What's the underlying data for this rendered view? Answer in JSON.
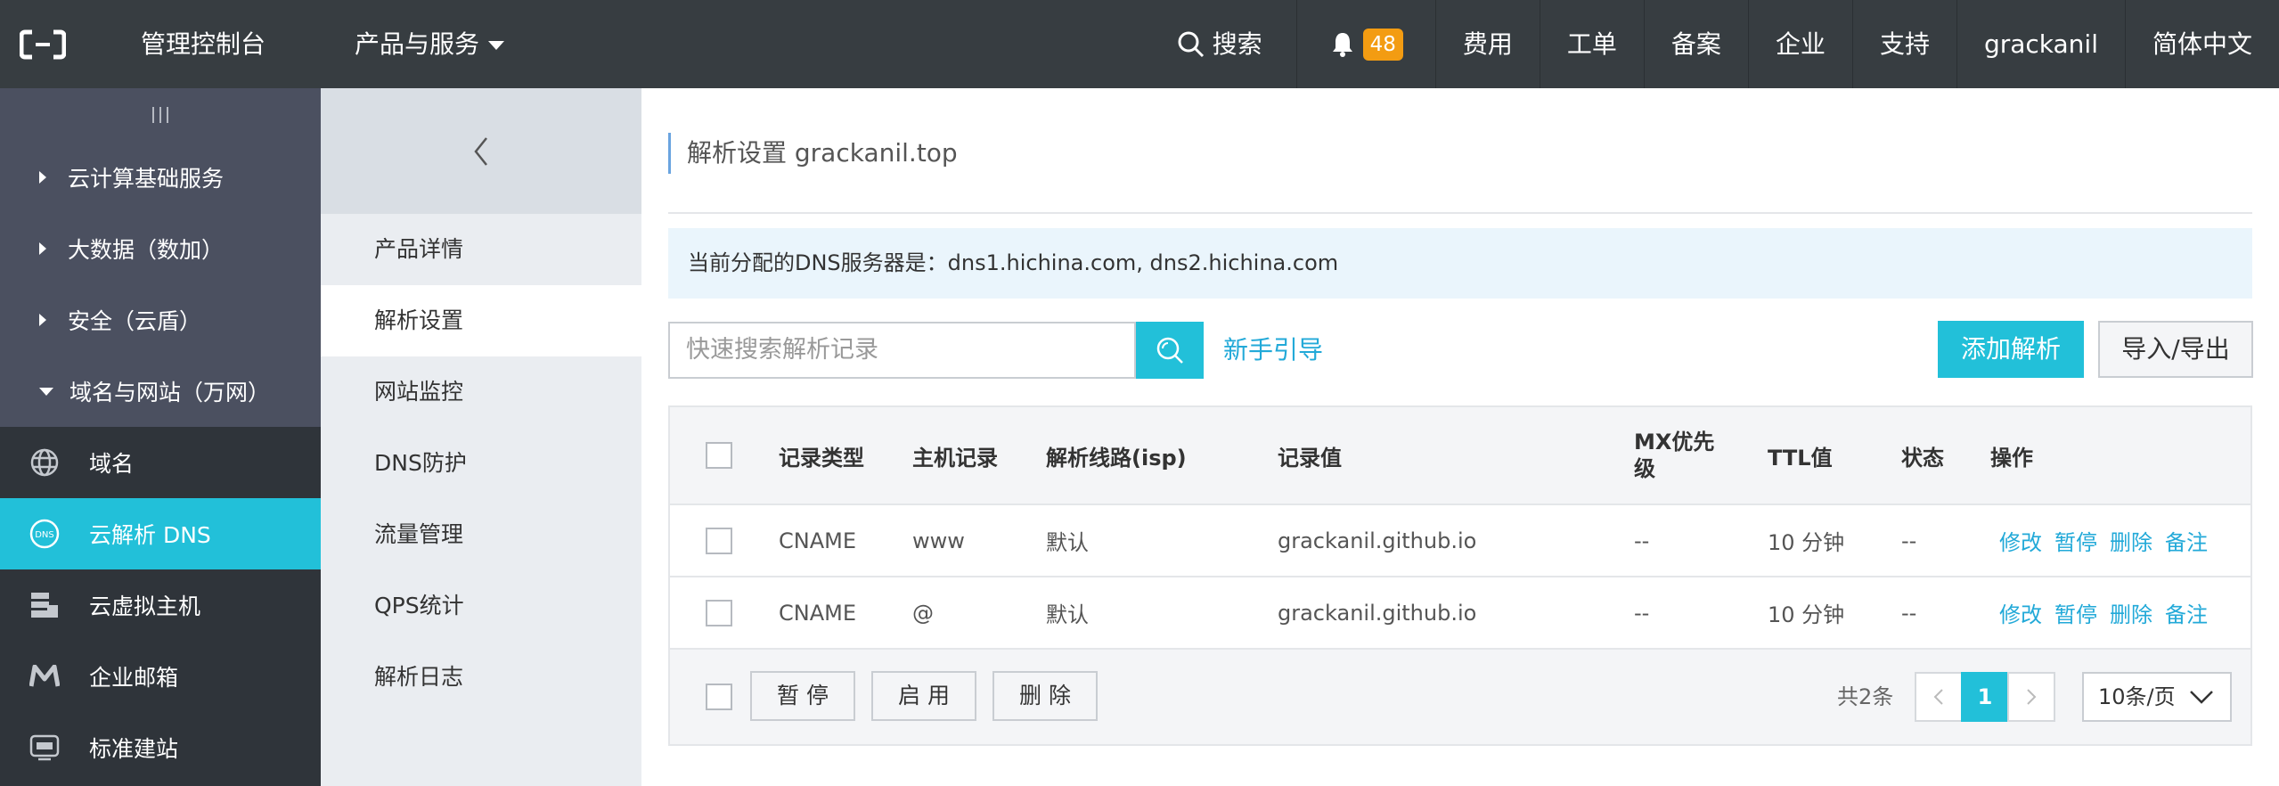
{
  "topbar": {
    "brand": "管理控制台",
    "products": "产品与服务",
    "search": "搜索",
    "notification_count": "48",
    "nav": [
      "费用",
      "工单",
      "备案",
      "企业",
      "支持",
      "grackanil",
      "简体中文"
    ]
  },
  "sidebar": {
    "groups": [
      {
        "label": "云计算基础服务"
      },
      {
        "label": "大数据（数加）"
      },
      {
        "label": "安全（云盾）"
      },
      {
        "label": "域名与网站（万网）"
      }
    ],
    "items": [
      {
        "label": "域名",
        "icon": "globe-icon"
      },
      {
        "label": "云解析 DNS",
        "icon": "dns-icon"
      },
      {
        "label": "云虚拟主机",
        "icon": "server-icon"
      },
      {
        "label": "企业邮箱",
        "icon": "mail-icon"
      },
      {
        "label": "标准建站",
        "icon": "monitor-icon"
      }
    ]
  },
  "subnav": {
    "items": [
      "产品详情",
      "解析设置",
      "网站监控",
      "DNS防护",
      "流量管理",
      "QPS统计",
      "解析日志"
    ]
  },
  "main": {
    "title": "解析设置 grackanil.top",
    "notice": "当前分配的DNS服务器是：dns1.hichina.com, dns2.hichina.com",
    "search_placeholder": "快速搜索解析记录",
    "guide": "新手引导",
    "add_button": "添加解析",
    "import_export_button": "导入/导出",
    "columns": [
      "记录类型",
      "主机记录",
      "解析线路(isp)",
      "记录值",
      "MX优先级",
      "TTL值",
      "状态",
      "操作"
    ],
    "rows": [
      {
        "type": "CNAME",
        "host": "www",
        "line": "默认",
        "value": "grackanil.github.io",
        "mx": "--",
        "ttl": "10 分钟",
        "status": "--"
      },
      {
        "type": "CNAME",
        "host": "@",
        "line": "默认",
        "value": "grackanil.github.io",
        "mx": "--",
        "ttl": "10 分钟",
        "status": "--"
      }
    ],
    "row_actions": [
      "修改",
      "暂停",
      "删除",
      "备注"
    ],
    "footer": {
      "pause": "暂 停",
      "enable": "启 用",
      "delete": "删 除",
      "total": "共2条",
      "current_page": "1",
      "page_size": "10条/页"
    }
  },
  "colors": {
    "topbar": "#373d41",
    "accent": "#22c0d9",
    "link": "#22a9d8",
    "badge": "#f39c12"
  }
}
